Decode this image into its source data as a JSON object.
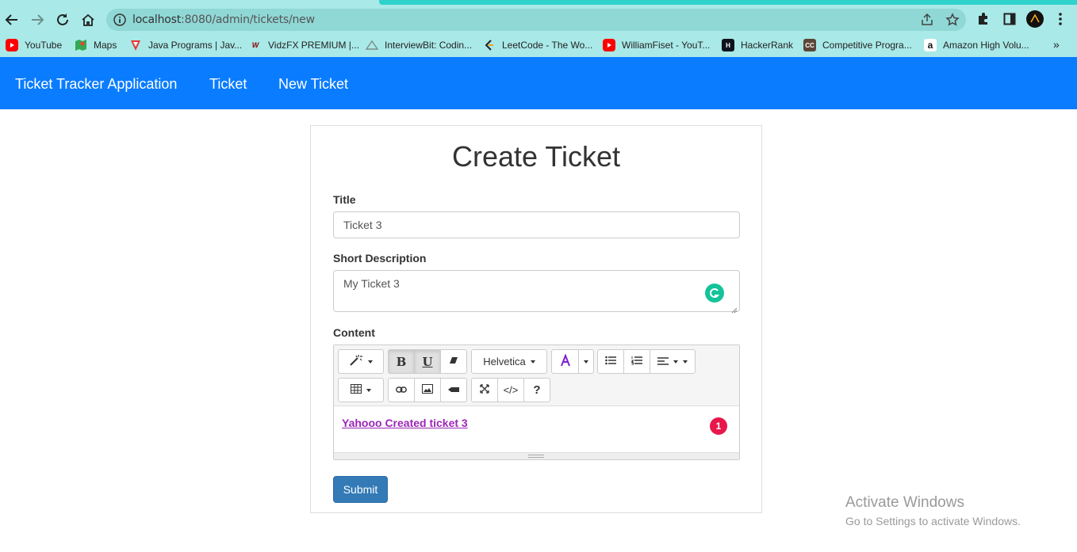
{
  "browser": {
    "url_host": "localhost",
    "url_path": ":8080/admin/tickets/new",
    "bookmarks": [
      {
        "label": "YouTube",
        "icon": "youtube-icon",
        "color": "#ff0000"
      },
      {
        "label": "Maps",
        "icon": "maps-icon",
        "color": "#34a853"
      },
      {
        "label": "Java Programs | Jav...",
        "icon": "java-programs-icon",
        "color": "#e53935"
      },
      {
        "label": "VidzFX PREMIUM |...",
        "icon": "vidzfx-icon",
        "color": "#8b0000"
      },
      {
        "label": "InterviewBit: Codin...",
        "icon": "interviewbit-icon",
        "color": "#7d8c8c"
      },
      {
        "label": "LeetCode - The Wo...",
        "icon": "leetcode-icon",
        "color": "#f89f1b"
      },
      {
        "label": "WilliamFiset - YouT...",
        "icon": "youtube-icon",
        "color": "#ff0000"
      },
      {
        "label": "HackerRank",
        "icon": "hackerrank-icon",
        "color": "#0e141e"
      },
      {
        "label": "Competitive Progra...",
        "icon": "cc-icon",
        "color": "#5b4638"
      },
      {
        "label": "Amazon High Volu...",
        "icon": "amazon-icon",
        "color": "#ffffff"
      }
    ]
  },
  "navbar": {
    "brand": "Ticket Tracker Application",
    "links": [
      "Ticket",
      "New Ticket"
    ],
    "bg_color": "#0a7cff"
  },
  "form": {
    "heading": "Create Ticket",
    "title_label": "Title",
    "title_value": "Ticket 3",
    "short_desc_label": "Short Description",
    "short_desc_value": "My Ticket 3",
    "content_label": "Content",
    "editor": {
      "font_name": "Helvetica",
      "content_text": "Yahooo Created ticket 3",
      "badge_count": "1",
      "bold_label": "B",
      "underline_label": "U",
      "help_label": "?",
      "code_label": "</>"
    },
    "submit_label": "Submit"
  },
  "watermark": {
    "line1": "Activate Windows",
    "line2": "Go to Settings to activate Windows."
  }
}
